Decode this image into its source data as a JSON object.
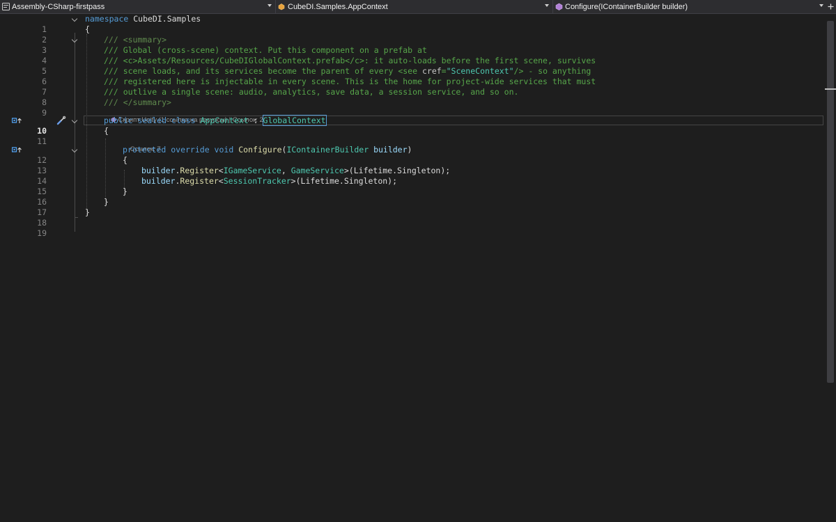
{
  "navbar": {
    "project": "Assembly-CSharp-firstpass",
    "type": "CubeDI.Samples.AppContext",
    "member": "Configure(IContainerBuilder builder)",
    "project_icon": "csharp-project-icon",
    "type_icon": "class-icon",
    "member_icon": "method-icon",
    "split_icon": "add-split-icon"
  },
  "editor": {
    "line_numbers": [
      "1",
      "2",
      "3",
      "4",
      "5",
      "6",
      "7",
      "8",
      "9",
      "10",
      "11",
      "12",
      "13",
      "14",
      "15",
      "16",
      "17",
      "18",
      "19"
    ],
    "active_line": "10",
    "code": {
      "l1_kw": "namespace",
      "l1_name": " CubeDI.Samples",
      "l2": "{",
      "l3_marker": "/// ",
      "l3_tag": "<summary>",
      "l4": "/// Global (cross-scene) context. Put this component on a prefab at",
      "l5": "/// <c>Assets/Resources/CubeDIGlobalContext.prefab</c>: it auto-loads before the first scene, survives",
      "l6_a": "/// scene loads, and its services become the parent of every <see ",
      "l6_attr": "cref",
      "l6_eq": "=",
      "l6_val": "\"SceneContext\"",
      "l6_b": "/> - so anything",
      "l7": "/// registered here is injectable in every scene. This is the home for project-wide services that must",
      "l8": "/// outlive a single scene: audio, analytics, save data, a session service, and so on.",
      "l9_marker": "/// ",
      "l9_tag": "</summary>",
      "l10_mods": "public sealed class",
      "l10_name": "AppContext",
      "l10_colon": " : ",
      "l10_base": "GlobalContext",
      "l11": "{",
      "l12_mods": "protected override void",
      "l12_method": "Configure",
      "l12_open": "(",
      "l12_ptype": "IContainerBuilder",
      "l12_pname": " builder",
      "l12_close": ")",
      "l13": "{",
      "l14_obj": "builder",
      "l14_dot": ".",
      "l14_fn": "Register",
      "l14_lt": "<",
      "l14_t1": "IGameService",
      "l14_comma": ", ",
      "l14_t2": "GameService",
      "l14_gt": ">(",
      "l14_enum": "Lifetime",
      "l14_dot2": ".",
      "l14_val": "Singleton",
      "l14_end": ");",
      "l15_obj": "builder",
      "l15_dot": ".",
      "l15_fn": "Register",
      "l15_lt": "<",
      "l15_t1": "SessionTracker",
      "l15_gt": ">(",
      "l15_enum": "Lifetime",
      "l15_dot2": ".",
      "l15_val": "Singleton",
      "l15_end": ");",
      "l16": "}",
      "l17": "}",
      "l18": "}"
    },
    "codelens": {
      "class_lens": "Скрипт Unity (1 ссылка на ресурсы) | Ссылок: 2",
      "class_lens_icon": "unity-icon",
      "method_lens": "Ссылок: 7"
    },
    "glyphs": {
      "override_icon": "override-arrow-icon",
      "quick_action_icon": "screwdriver-icon"
    }
  },
  "colors": {
    "background": "#1e1e1e",
    "keyword": "#569cd6",
    "type": "#4ec9b0",
    "method": "#dcdcaa",
    "comment": "#57a64a",
    "line_number": "#858585"
  }
}
